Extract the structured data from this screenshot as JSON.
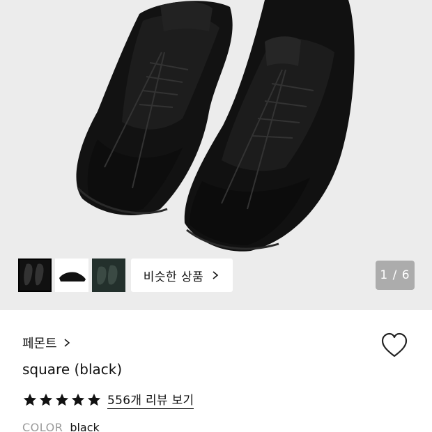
{
  "gallery": {
    "image_alt": "square (black)",
    "thumbnails": [
      {
        "name": "thumb-1",
        "active": true
      },
      {
        "name": "thumb-2",
        "active": false
      },
      {
        "name": "thumb-3",
        "active": false
      }
    ],
    "similar_label": "비슷한 상품",
    "pager_current": "1",
    "pager_separator": " / ",
    "pager_total": "6"
  },
  "product": {
    "brand": "페몬트",
    "title": "square (black)",
    "rating_stars": 5,
    "review_link": "556개 리뷰 보기",
    "color_label": "COLOR",
    "color_value": "black"
  },
  "icons": {
    "brand_chevron": "chevron-right-icon",
    "similar_chevron": "chevron-right-icon",
    "wishlist": "heart-icon",
    "star": "star-icon"
  },
  "colors": {
    "gallery_bg": "#ececec",
    "text": "#111111",
    "muted": "#9a9a9a",
    "pager_bg": "#787878"
  }
}
